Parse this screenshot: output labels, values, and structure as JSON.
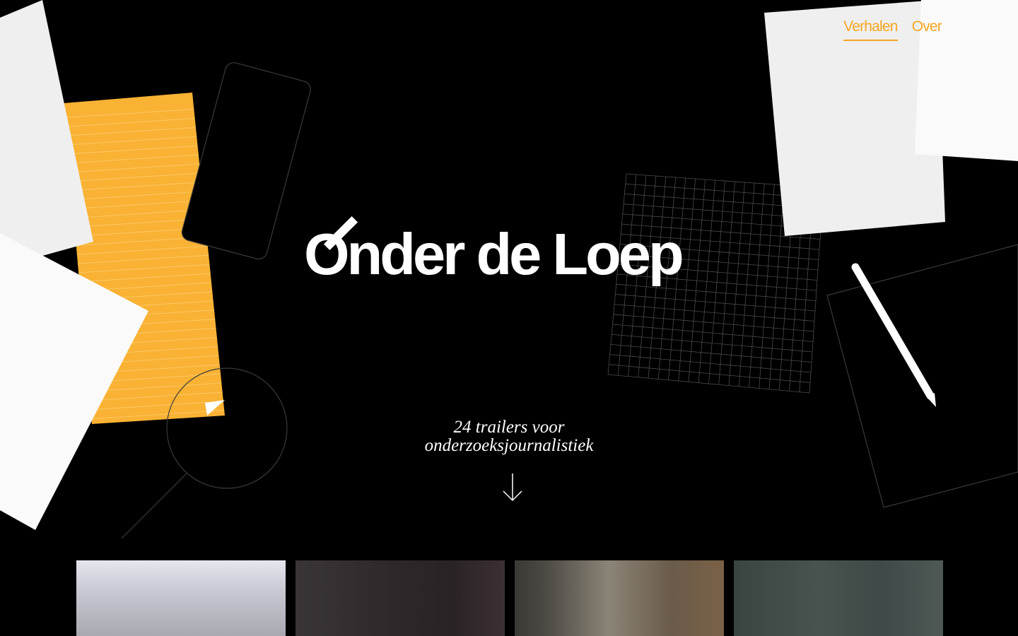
{
  "nav": {
    "items": [
      {
        "label": "Verhalen",
        "active": true
      },
      {
        "label": "Over",
        "active": false
      }
    ],
    "accent_color": "#f5a623"
  },
  "hero": {
    "title": "Onder de Loep",
    "tagline_line1": "24 trailers voor",
    "tagline_line2": "onderzoeksjournalistiek",
    "scroll_icon": "arrow-down-icon"
  },
  "colors": {
    "background": "#000000",
    "paper": "#f2f2f2",
    "notepad": "#f9b234"
  },
  "cards_count": 4
}
